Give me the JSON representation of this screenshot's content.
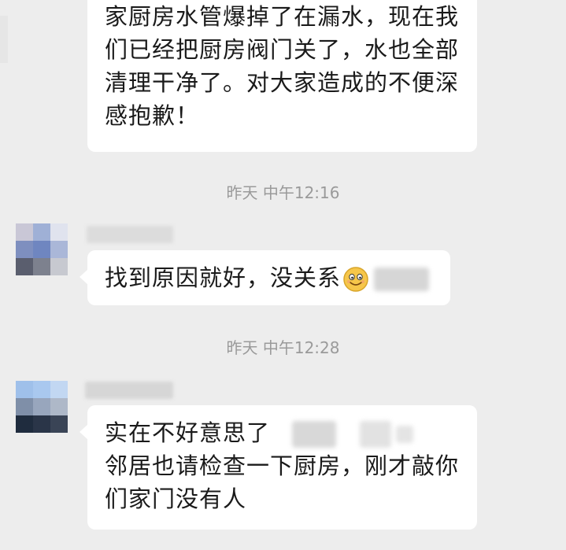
{
  "messages": [
    {
      "lines": [
        "家厨房水管爆掉了在漏水，现在我",
        "们已经把厨房阀门关了，水也全部",
        "清理干净了。对大家造成的不便深",
        "感抱歉！"
      ]
    },
    {
      "lines": [
        "找到原因就好，没关系"
      ],
      "emoji": "smile-emoji"
    },
    {
      "lines": [
        "实在不好意思了",
        "邻居也请检查一下厨房，刚才敲你",
        "们家门没有人"
      ]
    }
  ],
  "timestamps": [
    "昨天 中午12:16",
    "昨天 中午12:28"
  ],
  "colors": {
    "background": "#ededed",
    "bubble": "#ffffff",
    "text": "#1a1a1a",
    "timestamp": "#9a9a9a"
  }
}
